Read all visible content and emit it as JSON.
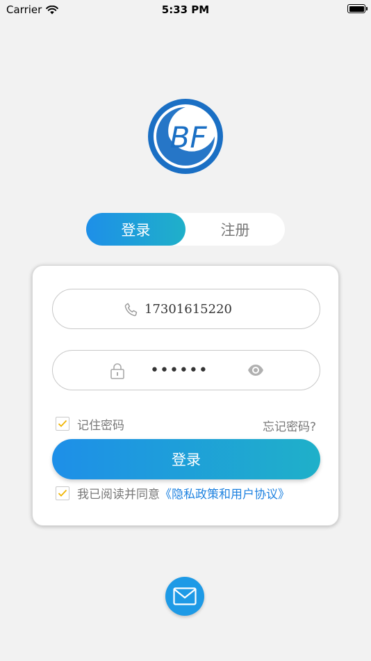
{
  "status_bar": {
    "carrier": "Carrier",
    "time": "5:33 PM"
  },
  "logo": {
    "text": "BF",
    "brand_color": "#1a6fc4"
  },
  "tabs": {
    "login": "登录",
    "register": "注册"
  },
  "form": {
    "phone_value": "17301615220",
    "password_value": "••••••",
    "remember_label": "记住密码",
    "forgot_label": "忘记密码?",
    "login_button": "登录",
    "agree_prefix": "我已阅读并同意",
    "agree_link": "《隐私政策和用户协议》"
  },
  "colors": {
    "accent_start": "#1e8fe8",
    "accent_end": "#1fb0c9",
    "link": "#1e82e0",
    "check": "#f0b400"
  },
  "icons": [
    "wifi-icon",
    "battery-icon",
    "phone-icon",
    "lock-icon",
    "eye-icon",
    "check-icon",
    "mail-icon"
  ]
}
